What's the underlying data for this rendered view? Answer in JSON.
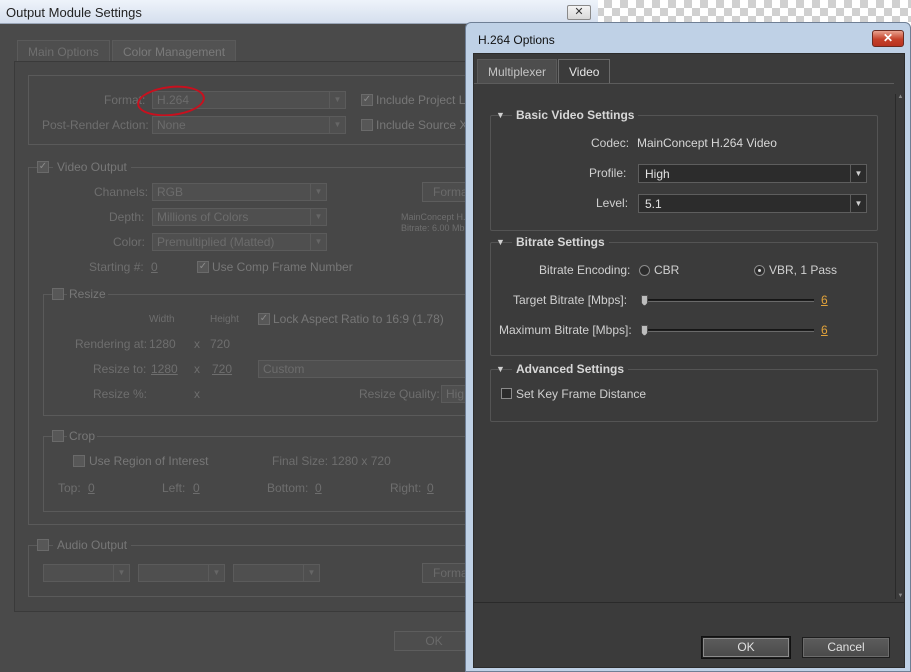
{
  "back_window": {
    "title": "Output Module Settings",
    "close_glyph": "✕",
    "tabs": [
      "Main Options",
      "Color Management"
    ],
    "format_label": "Format:",
    "format_value": "H.264",
    "post_render_label": "Post-Render Action:",
    "post_render_value": "None",
    "include_project_link": "Include Project Li",
    "include_source_xmp": "Include Source XM",
    "video_output": "Video Output",
    "channels_label": "Channels:",
    "channels_value": "RGB",
    "depth_label": "Depth:",
    "depth_value": "Millions of Colors",
    "color_label": "Color:",
    "color_value": "Premultiplied (Matted)",
    "format_options_btn": "Forma",
    "codec_summary_1": "MainConcept H.",
    "codec_summary_2": "Bitrate: 6.00 Mb",
    "starting_label": "Starting #:",
    "starting_value": "0",
    "use_comp_frame": "Use Comp Frame Number",
    "resize": "Resize",
    "width_hdr": "Width",
    "height_hdr": "Height",
    "lock_aspect": "Lock Aspect Ratio to 16:9 (1.78)",
    "rendering_at_label": "Rendering at:",
    "rendering_w": "1280",
    "rendering_x": "x",
    "rendering_h": "720",
    "resize_to_label": "Resize to:",
    "resize_w": "1280",
    "resize_h": "720",
    "resize_preset": "Custom",
    "resize_pct_label": "Resize %:",
    "resize_quality_label": "Resize Quality:",
    "resize_quality_value": "Hig",
    "crop": "Crop",
    "use_roi": "Use Region of Interest",
    "final_size": "Final Size: 1280 x 720",
    "top_label": "Top:",
    "top_value": "0",
    "left_label": "Left:",
    "left_value": "0",
    "bottom_label": "Bottom:",
    "bottom_value": "0",
    "right_label": "Right:",
    "right_value": "0",
    "audio_output": "Audio Output",
    "audio_format_btn": "Forma",
    "ok_label": "OK"
  },
  "front_window": {
    "title": "H.264 Options",
    "close_glyph": "✕",
    "tabs": [
      "Multiplexer",
      "Video"
    ],
    "basic": {
      "heading": "Basic Video Settings",
      "codec_label": "Codec:",
      "codec_value": "MainConcept H.264 Video",
      "profile_label": "Profile:",
      "profile_value": "High",
      "level_label": "Level:",
      "level_value": "5.1"
    },
    "bitrate": {
      "heading": "Bitrate Settings",
      "encoding_label": "Bitrate Encoding:",
      "cbr_label": "CBR",
      "vbr_label": "VBR, 1 Pass",
      "selected": "VBR, 1 Pass",
      "target_label": "Target Bitrate [Mbps]:",
      "target_value": "6",
      "max_label": "Maximum Bitrate [Mbps]:",
      "max_value": "6"
    },
    "advanced": {
      "heading": "Advanced Settings",
      "key_frame_label": "Set Key Frame Distance"
    },
    "ok_label": "OK",
    "cancel_label": "Cancel"
  },
  "colors": {
    "accent_orange": "#e1a23a",
    "annotation_red": "#c8101e"
  }
}
